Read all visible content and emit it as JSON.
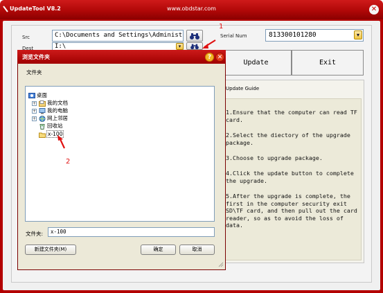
{
  "app": {
    "title": "UpdateTool V8.2",
    "url": "www.obdstar.com",
    "close_glyph": "✕"
  },
  "form": {
    "src_label": "Src",
    "src_value": "C:\\Documents and Settings\\Administ",
    "dest_label": "Dest",
    "dest_value": "I:\\",
    "serial_label": "Serial Num",
    "serial_value": "813300101280",
    "update_label": "Update",
    "exit_label": "Exit"
  },
  "guide": {
    "title": "Update Guide",
    "steps": [
      "1.Ensure that the computer can read TF card.",
      "2.Select the diectory of the upgrade package.",
      "3.Choose to upgrade package.",
      "4.Click the update button to complete the upgrade.",
      "5.After the upgrade is complete, the first in the computer security exit SD\\TF card, and then pull out the card reader, so as to avoid the loss of data."
    ]
  },
  "dialog": {
    "title": "浏览文件夹",
    "subtitle": "文件夹",
    "help_glyph": "?",
    "close_glyph": "✕",
    "tree": [
      {
        "label": "桌面",
        "icon": "desktop-icon",
        "expander": ""
      },
      {
        "label": "我的文档",
        "icon": "my-documents-icon",
        "expander": "+"
      },
      {
        "label": "我的电脑",
        "icon": "my-computer-icon",
        "expander": "+"
      },
      {
        "label": "网上邻居",
        "icon": "network-icon",
        "expander": "+"
      },
      {
        "label": "回收站",
        "icon": "recycle-bin-icon",
        "expander": ""
      },
      {
        "label": "x-100",
        "icon": "folder-icon",
        "expander": ""
      }
    ],
    "folder_label": "文件夹:",
    "folder_value": "x-100",
    "new_folder_label": "新建文件夹(M)",
    "ok_label": "确定",
    "cancel_label": "取消"
  },
  "annotations": {
    "marker1": "1",
    "marker2": "2",
    "color": "#e01010"
  }
}
